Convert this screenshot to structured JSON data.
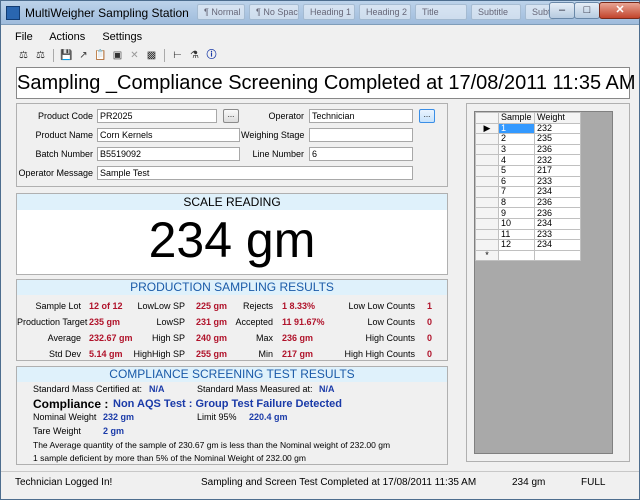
{
  "window": {
    "title": "MultiWeigher Sampling Station",
    "background_tabs": [
      "¶ Normal",
      "¶ No Spacing",
      "Heading 1",
      "Heading 2",
      "Title",
      "Subtitle",
      "Subtle Emp..."
    ],
    "min_label": "–",
    "max_label": "□",
    "close_label": "✕"
  },
  "menu": [
    "File",
    "Actions",
    "Settings"
  ],
  "toolbar": {
    "icons": [
      "scale-icon",
      "scale2-icon",
      "save-icon",
      "export-icon",
      "report-icon",
      "window-icon",
      "delete-icon",
      "chart-icon",
      "cursor-icon",
      "tare-icon",
      "info-icon"
    ]
  },
  "banner": "Sampling _Compliance Screening Completed at 17/08/2011  11:35 AM",
  "product": {
    "product_code_label": "Product Code",
    "product_code": "PR2025",
    "product_name_label": "Product Name",
    "product_name": "Corn Kernels",
    "batch_label": "Batch Number",
    "batch": "B5519092",
    "operator_msg_label": "Operator Message",
    "operator_msg": "Sample Test",
    "operator_label": "Operator",
    "operator": "Technician",
    "weighing_stage_label": "Weighing Stage",
    "weighing_stage": "",
    "line_label": "Line Number",
    "line": "6",
    "dots": "..."
  },
  "scale": {
    "header": "SCALE READING",
    "reading": "234 gm"
  },
  "production": {
    "header": "PRODUCTION SAMPLING RESULTS",
    "col1": [
      {
        "label": "Sample Lot",
        "value": "12 of 12"
      },
      {
        "label": "Production Target",
        "value": "235 gm"
      },
      {
        "label": "Average",
        "value": "232.67 gm"
      },
      {
        "label": "Std Dev",
        "value": "5.14 gm"
      }
    ],
    "col2": [
      {
        "label": "LowLow SP",
        "value": "225 gm"
      },
      {
        "label": "LowSP",
        "value": "231 gm"
      },
      {
        "label": "High SP",
        "value": "240 gm"
      },
      {
        "label": "HighHigh SP",
        "value": "255 gm"
      }
    ],
    "col3": [
      {
        "label": "Rejects",
        "value": "1  8.33%"
      },
      {
        "label": "Accepted",
        "value": "11  91.67%"
      },
      {
        "label": "Max",
        "value": "236 gm"
      },
      {
        "label": "Min",
        "value": "217 gm"
      }
    ],
    "col4": [
      {
        "label": "Low Low Counts",
        "value": "1"
      },
      {
        "label": "Low Counts",
        "value": "0"
      },
      {
        "label": "High Counts",
        "value": "0"
      },
      {
        "label": "High High Counts",
        "value": "0"
      }
    ]
  },
  "compliance": {
    "header": "COMPLIANCE SCREENING TEST RESULTS",
    "std_certified_label": "Standard Mass Certified at:",
    "std_certified": "N/A",
    "std_measured_label": "Standard Mass Measured at:",
    "std_measured": "N/A",
    "compliance_label": "Compliance :",
    "compliance_result": "Non AQS Test : Group Test Failure Detected",
    "nominal_label": "Nominal Weight",
    "nominal": "232 gm",
    "limit_label": "Limit 95%",
    "limit": "220.4 gm",
    "tare_label": "Tare Weight",
    "tare": "2 gm",
    "note1": "The Average quantity of the sample of 230.67 gm is less than the Nominal weight of 232.00 gm",
    "note2": "1 sample deficient by more than 5% of the Nominal Weight of 232.00 gm"
  },
  "grid": {
    "headers": [
      "Sample",
      "Weight"
    ],
    "rows": [
      [
        "1",
        "232"
      ],
      [
        "2",
        "235"
      ],
      [
        "3",
        "236"
      ],
      [
        "4",
        "232"
      ],
      [
        "5",
        "217"
      ],
      [
        "6",
        "233"
      ],
      [
        "7",
        "234"
      ],
      [
        "8",
        "236"
      ],
      [
        "9",
        "236"
      ],
      [
        "10",
        "234"
      ],
      [
        "11",
        "233"
      ],
      [
        "12",
        "234"
      ]
    ],
    "new_row_marker": "*",
    "current_row_marker": "▶"
  },
  "status": {
    "login": "Technician Logged In!",
    "message": "Sampling and Screen Test Completed at 17/08/2011  11:35 AM",
    "reading": "234 gm",
    "mode": "FULL"
  }
}
